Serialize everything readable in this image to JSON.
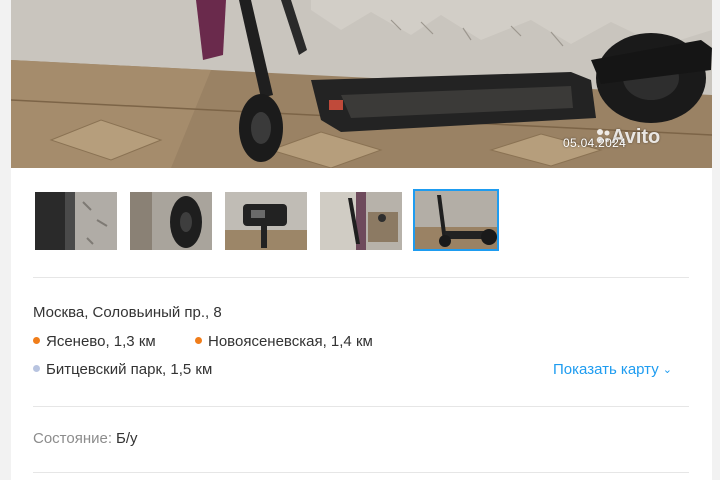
{
  "photo": {
    "date_stamp": "05.04.2024",
    "watermark": "Avito"
  },
  "gallery": {
    "thumbnails": [
      {
        "subject": "scooter-deck-closeup"
      },
      {
        "subject": "scooter-wheel-closeup"
      },
      {
        "subject": "scooter-display-closeup"
      },
      {
        "subject": "scooter-folded-side"
      },
      {
        "subject": "scooter-full-view",
        "selected": true
      }
    ]
  },
  "location": {
    "address": "Москва, Соловьиный пр., 8",
    "metro": [
      {
        "name": "Ясенево",
        "distance": "1,3 км",
        "color": "#f07d1a"
      },
      {
        "name": "Новоясеневская",
        "distance": "1,4 км",
        "color": "#f07d1a"
      },
      {
        "name": "Битцевский парк",
        "distance": "1,5 км",
        "color": "#b8c4e0"
      }
    ],
    "show_map_label": "Показать карту",
    "show_map_icon": "chevron-down-icon"
  },
  "details": {
    "condition_label": "Состояние:",
    "condition_value": "Б/у"
  },
  "colors": {
    "link": "#1e9cf0",
    "divider": "#e6e6e6",
    "muted_text": "#8c8c8c"
  }
}
